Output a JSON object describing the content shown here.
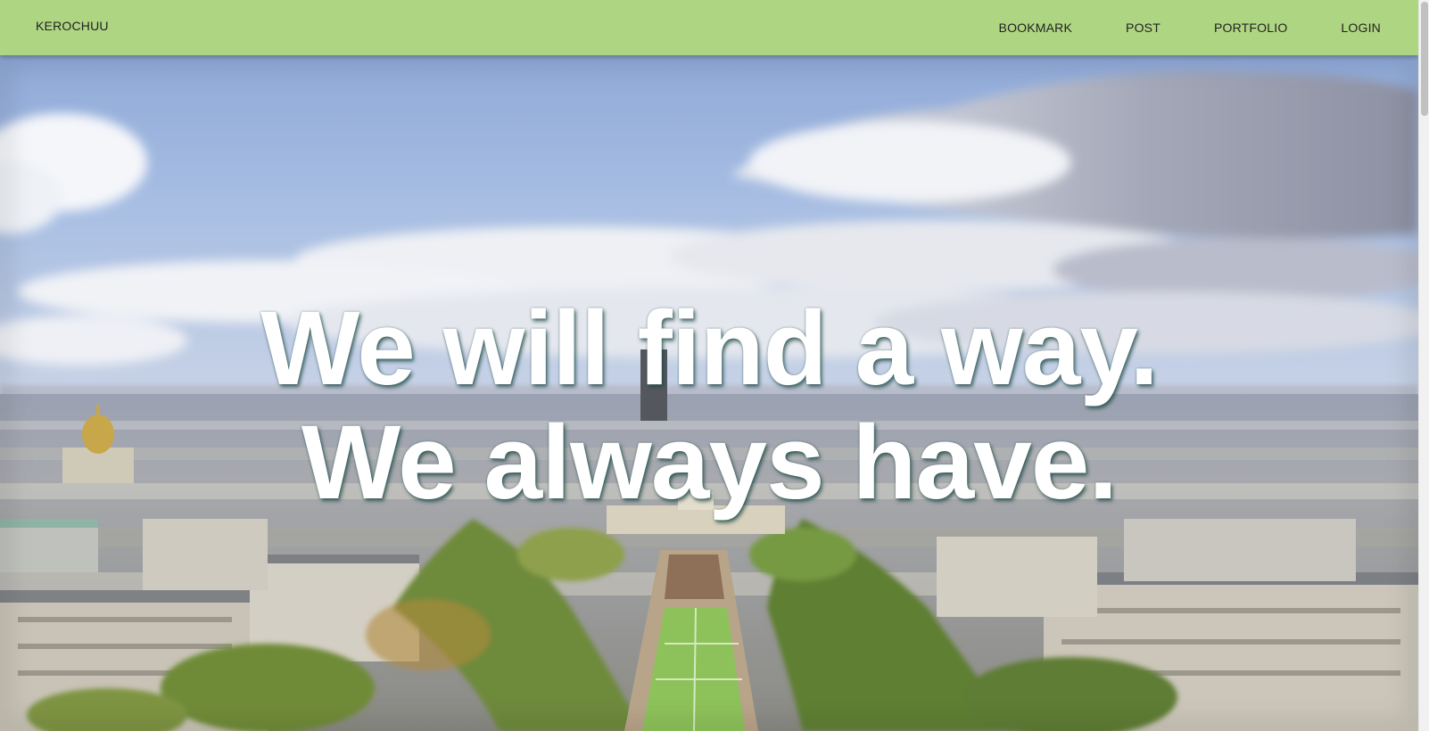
{
  "nav": {
    "brand": "KEROCHUU",
    "links": [
      "BOOKMARK",
      "POST",
      "PORTFOLIO",
      "LOGIN"
    ]
  },
  "hero": {
    "line1": "We will find a way.",
    "line2": "We always have."
  },
  "colors": {
    "navbar": "#aed581",
    "hero_text": "#ffffff",
    "text_shadow": "#184642"
  }
}
